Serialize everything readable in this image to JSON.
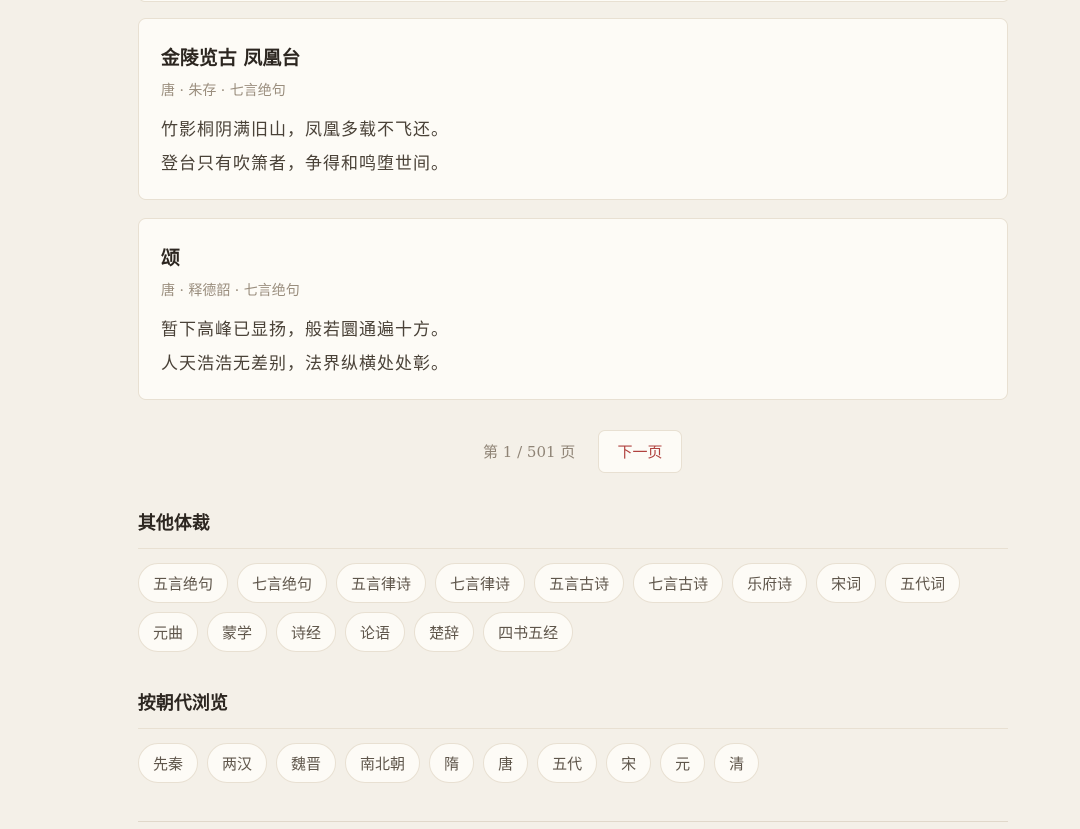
{
  "poems": [
    {
      "title": "金陵览古 凤凰台",
      "meta": "唐 · 朱存 · 七言绝句",
      "lines": [
        "竹影桐阴满旧山，凤凰多载不飞还。",
        "登台只有吹箫者，争得和鸣堕世间。"
      ]
    },
    {
      "title": "颂",
      "meta": "唐 · 释德韶 · 七言绝句",
      "lines": [
        "暂下高峰已显扬，般若圜通遍十方。",
        "人天浩浩无差别，法界纵横处处彰。"
      ]
    }
  ],
  "pager": {
    "info": "第 1 / 501 页",
    "next_label": "下一页"
  },
  "genres": {
    "title": "其他体裁",
    "items": [
      "五言绝句",
      "七言绝句",
      "五言律诗",
      "七言律诗",
      "五言古诗",
      "七言古诗",
      "乐府诗",
      "宋词",
      "五代词",
      "元曲",
      "蒙学",
      "诗经",
      "论语",
      "楚辞",
      "四书五经"
    ]
  },
  "dynasties": {
    "title": "按朝代浏览",
    "items": [
      "先秦",
      "两汉",
      "魏晋",
      "南北朝",
      "隋",
      "唐",
      "五代",
      "宋",
      "元",
      "清"
    ]
  },
  "colors": {
    "background": "#f4f0e8",
    "card": "#fdfbf6",
    "border": "#e8e0d2",
    "accent": "#b0413e"
  }
}
